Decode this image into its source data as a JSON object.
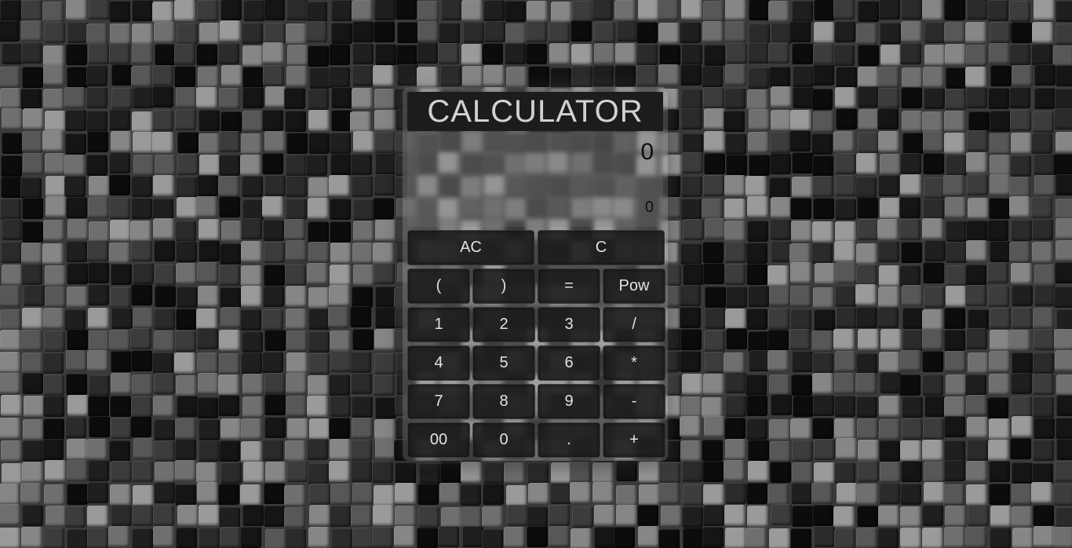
{
  "calculator": {
    "title": "CALCULATOR",
    "display_main": "0",
    "display_secondary": "0"
  },
  "buttons": {
    "ac": "AC",
    "c": "C",
    "open_paren": "(",
    "close_paren": ")",
    "equals": "=",
    "pow": "Pow",
    "one": "1",
    "two": "2",
    "three": "3",
    "divide": "/",
    "four": "4",
    "five": "5",
    "six": "6",
    "multiply": "*",
    "seven": "7",
    "eight": "8",
    "nine": "9",
    "minus": "-",
    "double_zero": "00",
    "zero": "0",
    "decimal": ".",
    "plus": "+"
  },
  "colors": {
    "title_bg": "#1c1c1c",
    "title_text": "#d2d2d2",
    "button_bg": "#1c1c1c",
    "button_text": "#e2e2e2",
    "display_text": "#0e0e0e"
  }
}
